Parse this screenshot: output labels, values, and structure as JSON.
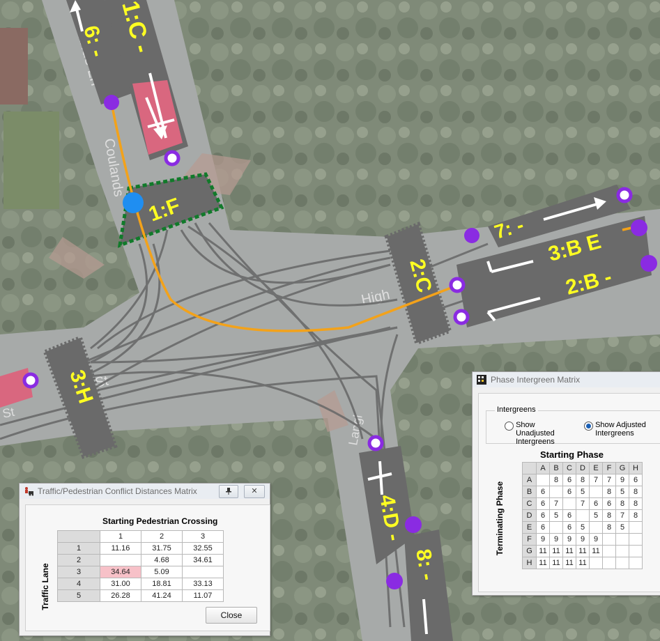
{
  "map": {
    "streets": {
      "coulands_ln_top": "Coulands Ln",
      "coulands_ln_side": "Coulands",
      "high_st": "High",
      "st_left": "St",
      "st_far_left": "St",
      "langley": "Langl"
    },
    "stream_labels": {
      "s1C": "1:C -",
      "s6": "6: -",
      "s1F": "1:F",
      "s7": "7: -",
      "s3BE": "3:B E",
      "s2B": "2:B -",
      "s2C": "2:C",
      "s3H": "3:H",
      "s4D": "4:D -",
      "s8": "8: -"
    },
    "colors": {
      "lane": "#6a6a6a",
      "route": "#f3a21a",
      "node": "#8a2be2",
      "crossing": "#d9677f",
      "label": "#ffff22"
    }
  },
  "conflict_dialog": {
    "title": "Traffic/Pedestrian Conflict Distances Matrix",
    "col_header": "Starting Pedestrian Crossing",
    "row_header": "Traffic Lane",
    "columns": [
      "1",
      "2",
      "3"
    ],
    "rows": [
      {
        "label": "1",
        "cells": [
          "11.16",
          "31.75",
          "32.55"
        ]
      },
      {
        "label": "2",
        "cells": [
          "",
          "4.68",
          "34.61"
        ]
      },
      {
        "label": "3",
        "cells": [
          "34.64",
          "5.09",
          ""
        ]
      },
      {
        "label": "4",
        "cells": [
          "31.00",
          "18.81",
          "33.13"
        ]
      },
      {
        "label": "5",
        "cells": [
          "26.28",
          "41.24",
          "11.07"
        ]
      }
    ],
    "highlight": {
      "row": 2,
      "col": 0
    },
    "close_label": "Close"
  },
  "intergreen_dialog": {
    "title": "Phase Intergreen Matrix",
    "group_label": "Intergreens",
    "radio_unadjusted": "Show Unadjusted Intergreens",
    "radio_adjusted": "Show Adjusted Intergreens",
    "selected": "adjusted",
    "col_header": "Starting Phase",
    "row_header": "Terminating Phase",
    "columns": [
      "A",
      "B",
      "C",
      "D",
      "E",
      "F",
      "G",
      "H"
    ],
    "rows": [
      {
        "label": "A",
        "cells": [
          "",
          "8",
          "6",
          "8",
          "7",
          "7",
          "9",
          "6"
        ]
      },
      {
        "label": "B",
        "cells": [
          "6",
          "",
          "6",
          "5",
          "",
          "8",
          "5",
          "8"
        ]
      },
      {
        "label": "C",
        "cells": [
          "6",
          "7",
          "",
          "7",
          "6",
          "6",
          "8",
          "8"
        ]
      },
      {
        "label": "D",
        "cells": [
          "6",
          "5",
          "6",
          "",
          "5",
          "8",
          "7",
          "8"
        ]
      },
      {
        "label": "E",
        "cells": [
          "6",
          "",
          "6",
          "5",
          "",
          "8",
          "5",
          ""
        ]
      },
      {
        "label": "F",
        "cells": [
          "9",
          "9",
          "9",
          "9",
          "9",
          "",
          "",
          ""
        ]
      },
      {
        "label": "G",
        "cells": [
          "11",
          "11",
          "11",
          "11",
          "11",
          "",
          "",
          ""
        ]
      },
      {
        "label": "H",
        "cells": [
          "11",
          "11",
          "11",
          "11",
          "",
          "",
          "",
          ""
        ]
      }
    ]
  }
}
